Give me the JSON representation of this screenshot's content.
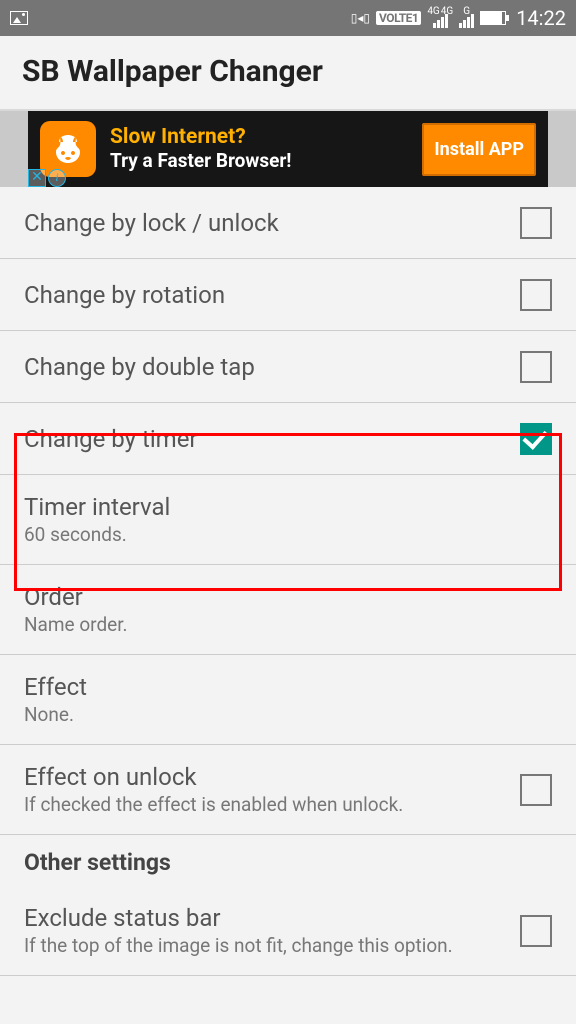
{
  "status": {
    "volte": "VOLTE1",
    "net1": "4G",
    "net2": "4G",
    "net3": "G",
    "time": "14:22"
  },
  "title": "SB Wallpaper Changer",
  "ad": {
    "line1": "Slow Internet?",
    "line2": "Try a Faster Browser!",
    "cta": "Install APP"
  },
  "rows": {
    "lock": "Change by lock / unlock",
    "rotation": "Change by rotation",
    "double": "Change by double tap",
    "timer": "Change by timer",
    "interval_t": "Timer interval",
    "interval_s": "60 seconds.",
    "order_t": "Order",
    "order_s": "Name order.",
    "effect_t": "Effect",
    "effect_s": "None.",
    "eunlock_t": "Effect on unlock",
    "eunlock_s": "If checked the effect is enabled when unlock.",
    "section_other": "Other settings",
    "exclude_t": "Exclude status bar",
    "exclude_s": "If the top of the image is not fit, change this option."
  }
}
